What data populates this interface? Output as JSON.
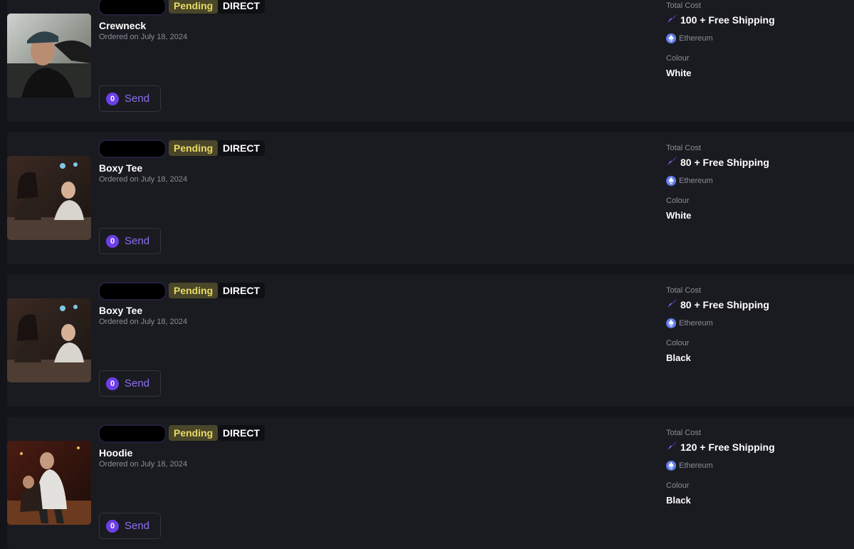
{
  "orders": [
    {
      "status": "Pending",
      "channel": "DIRECT",
      "product": "Crewneck",
      "ordered": "Ordered on July 18, 2024",
      "send_count": "0",
      "send_label": "Send",
      "total_cost_label": "Total Cost",
      "total_cost": "100 + Free Shipping",
      "chain": "Ethereum",
      "colour_label": "Colour",
      "colour": "White"
    },
    {
      "status": "Pending",
      "channel": "DIRECT",
      "product": "Boxy Tee",
      "ordered": "Ordered on July 18, 2024",
      "send_count": "0",
      "send_label": "Send",
      "total_cost_label": "Total Cost",
      "total_cost": "80 + Free Shipping",
      "chain": "Ethereum",
      "colour_label": "Colour",
      "colour": "White"
    },
    {
      "status": "Pending",
      "channel": "DIRECT",
      "product": "Boxy Tee",
      "ordered": "Ordered on July 18, 2024",
      "send_count": "0",
      "send_label": "Send",
      "total_cost_label": "Total Cost",
      "total_cost": "80 + Free Shipping",
      "chain": "Ethereum",
      "colour_label": "Colour",
      "colour": "Black"
    },
    {
      "status": "Pending",
      "channel": "DIRECT",
      "product": "Hoodie",
      "ordered": "Ordered on July 18, 2024",
      "send_count": "0",
      "send_label": "Send",
      "total_cost_label": "Total Cost",
      "total_cost": "120 + Free Shipping",
      "chain": "Ethereum",
      "colour_label": "Colour",
      "colour": "Black"
    }
  ],
  "icons": {
    "currency": "token-icon",
    "chain": "ethereum-icon"
  },
  "colors": {
    "accent": "#6c3fe8",
    "pending": "#e8db63",
    "ethereum": "#627eea"
  }
}
